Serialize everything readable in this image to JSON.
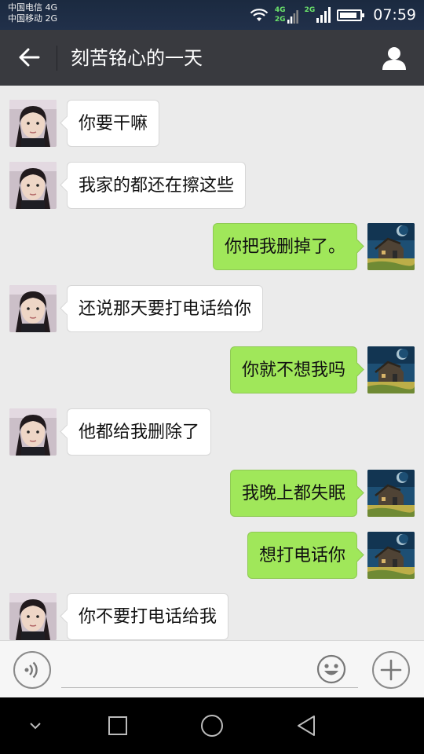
{
  "status_bar": {
    "carrier_1": "中国电信 4G",
    "carrier_2": "中国移动 2G",
    "net_tag_4g": "4G",
    "net_tag_2g_a": "2G",
    "net_tag_2g_b": "2G",
    "time": "07:59",
    "battery_level": 0.9,
    "icons": [
      "wifi-icon",
      "signal-4g-icon",
      "signal-2g-icon",
      "battery-icon"
    ]
  },
  "title_bar": {
    "title": "刻苦铭心的一天",
    "back_icon": "back-arrow-icon",
    "profile_icon": "person-icon"
  },
  "messages": [
    {
      "side": "left",
      "text": "你要干嘛"
    },
    {
      "side": "left",
      "text": "我家的都还在擦这些"
    },
    {
      "side": "right",
      "text": "你把我删掉了。"
    },
    {
      "side": "left",
      "text": "还说那天要打电话给你"
    },
    {
      "side": "right",
      "text": "你就不想我吗"
    },
    {
      "side": "left",
      "text": "他都给我删除了"
    },
    {
      "side": "right",
      "text": "我晚上都失眠"
    },
    {
      "side": "right",
      "text": "想打电话你"
    },
    {
      "side": "left",
      "text": "你不要打电话给我"
    }
  ],
  "input_bar": {
    "value": "",
    "placeholder": "",
    "voice_icon": "voice-icon",
    "emoji_icon": "emoji-icon",
    "plus_icon": "plus-icon"
  },
  "nav_bar": {
    "icons": [
      "chevron-down-icon",
      "recents-square-icon",
      "home-circle-icon",
      "back-triangle-icon"
    ]
  },
  "colors": {
    "title_bar_bg": "#393a3f",
    "chat_bg": "#ebebeb",
    "bubble_self": "#a0e75a",
    "bubble_other": "#ffffff"
  }
}
